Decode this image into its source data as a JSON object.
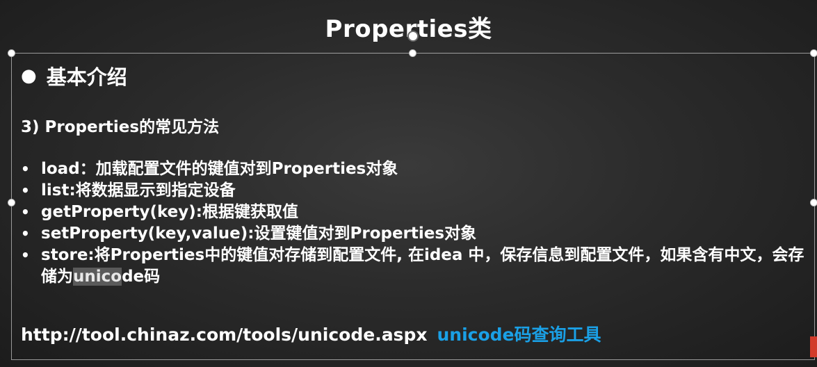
{
  "slide": {
    "title": "Properties类",
    "heading": "基本介绍",
    "subheading": "3) Properties的常见方法",
    "methods": [
      {
        "text": "load：加载配置文件的键值对到Properties对象"
      },
      {
        "text": "list:将数据显示到指定设备"
      },
      {
        "text": "getProperty(key):根据键获取值"
      },
      {
        "text": "setProperty(key,value):设置键值对到Properties对象"
      },
      {
        "pre": "store:将Properties中的键值对存储到配置文件, 在idea 中，保存信息到配置文件，如果含有中文，会存储为",
        "highlight": "unico",
        "post": "de码"
      }
    ],
    "link_url": "http://tool.chinaz.com/tools/unicode.aspx",
    "link_tool": "unicode码查询工具",
    "accent_color": "#1aa0e6",
    "background_color": "#2b2b2b"
  }
}
